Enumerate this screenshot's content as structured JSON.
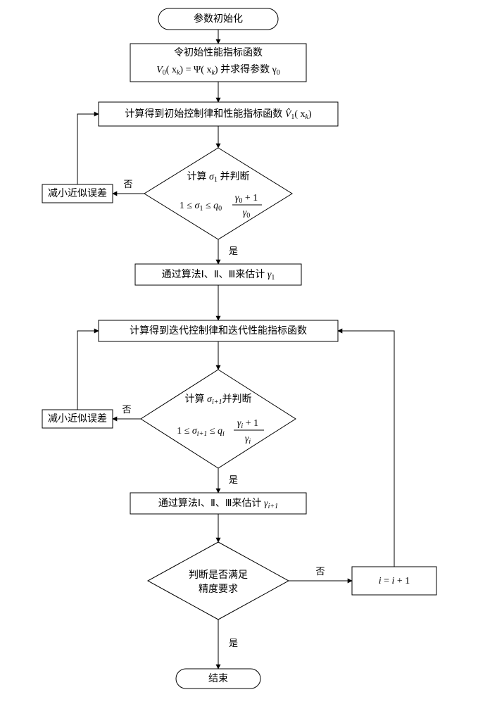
{
  "nodes": {
    "start": {
      "label": "参数初始化"
    },
    "init_fn": {
      "line1": "令初始性能指标函数",
      "eq_left": "V",
      "eq_left_sub": "0",
      "eq_arg": "( x",
      "eq_arg_sub": "k",
      "eq_arg_close": ")",
      "eq_psi": " = Ψ( x",
      "eq_psi_sub": "k",
      "eq_psi_close": ")",
      "tail": " 并求得参数 γ",
      "tail_sub": "0"
    },
    "calc_init": {
      "line1_pre": "计算得到初始控制律和性能指标函数 ",
      "sym": "V̂",
      "sym_sub": "1",
      "arg": "( x",
      "arg_sub": "k",
      "arg_close": ")"
    },
    "dec1": {
      "line1_pre": "计算 ",
      "sigma": "σ",
      "sigma_sub": "1",
      "line1_post": " 并判断",
      "ineq_start": "1 ≤ ",
      "s1": "σ",
      "s1_sub": "1",
      "mid": " ≤ ",
      "q": "q",
      "q_sub": "0",
      "frac_top_g": "γ",
      "frac_top_sub": "0",
      "frac_top_plus": " + 1",
      "frac_bot_g": "γ",
      "frac_bot_sub": "0"
    },
    "reduce1": {
      "label": "减小近似误差"
    },
    "est1": {
      "pre": "通过算法Ⅰ、Ⅱ、Ⅲ来估计 ",
      "g": "γ",
      "g_sub": "1"
    },
    "calc_iter": {
      "label": "计算得到迭代控制律和迭代性能指标函数"
    },
    "dec2": {
      "line1_pre": "计算 ",
      "sigma": "σ",
      "sigma_sub": "i+1",
      "line1_post": "并判断",
      "ineq_start": "1 ≤ ",
      "s1": "σ",
      "s1_sub": "i+1",
      "mid": " ≤ ",
      "q": "q",
      "q_sub": "i",
      "frac_top_g": "γ",
      "frac_top_sub": "i",
      "frac_top_plus": " + 1",
      "frac_bot_g": "γ",
      "frac_bot_sub": "i"
    },
    "reduce2": {
      "label": "减小近似误差"
    },
    "est2": {
      "pre": "通过算法Ⅰ、Ⅱ、Ⅲ来估计 ",
      "g": "γ",
      "g_sub": "i+1"
    },
    "dec3": {
      "line1": "判断是否满足",
      "line2": "精度要求"
    },
    "inc": {
      "eq": "i = i + 1"
    },
    "end": {
      "label": "结束"
    }
  },
  "edges": {
    "yes": "是",
    "no": "否"
  }
}
